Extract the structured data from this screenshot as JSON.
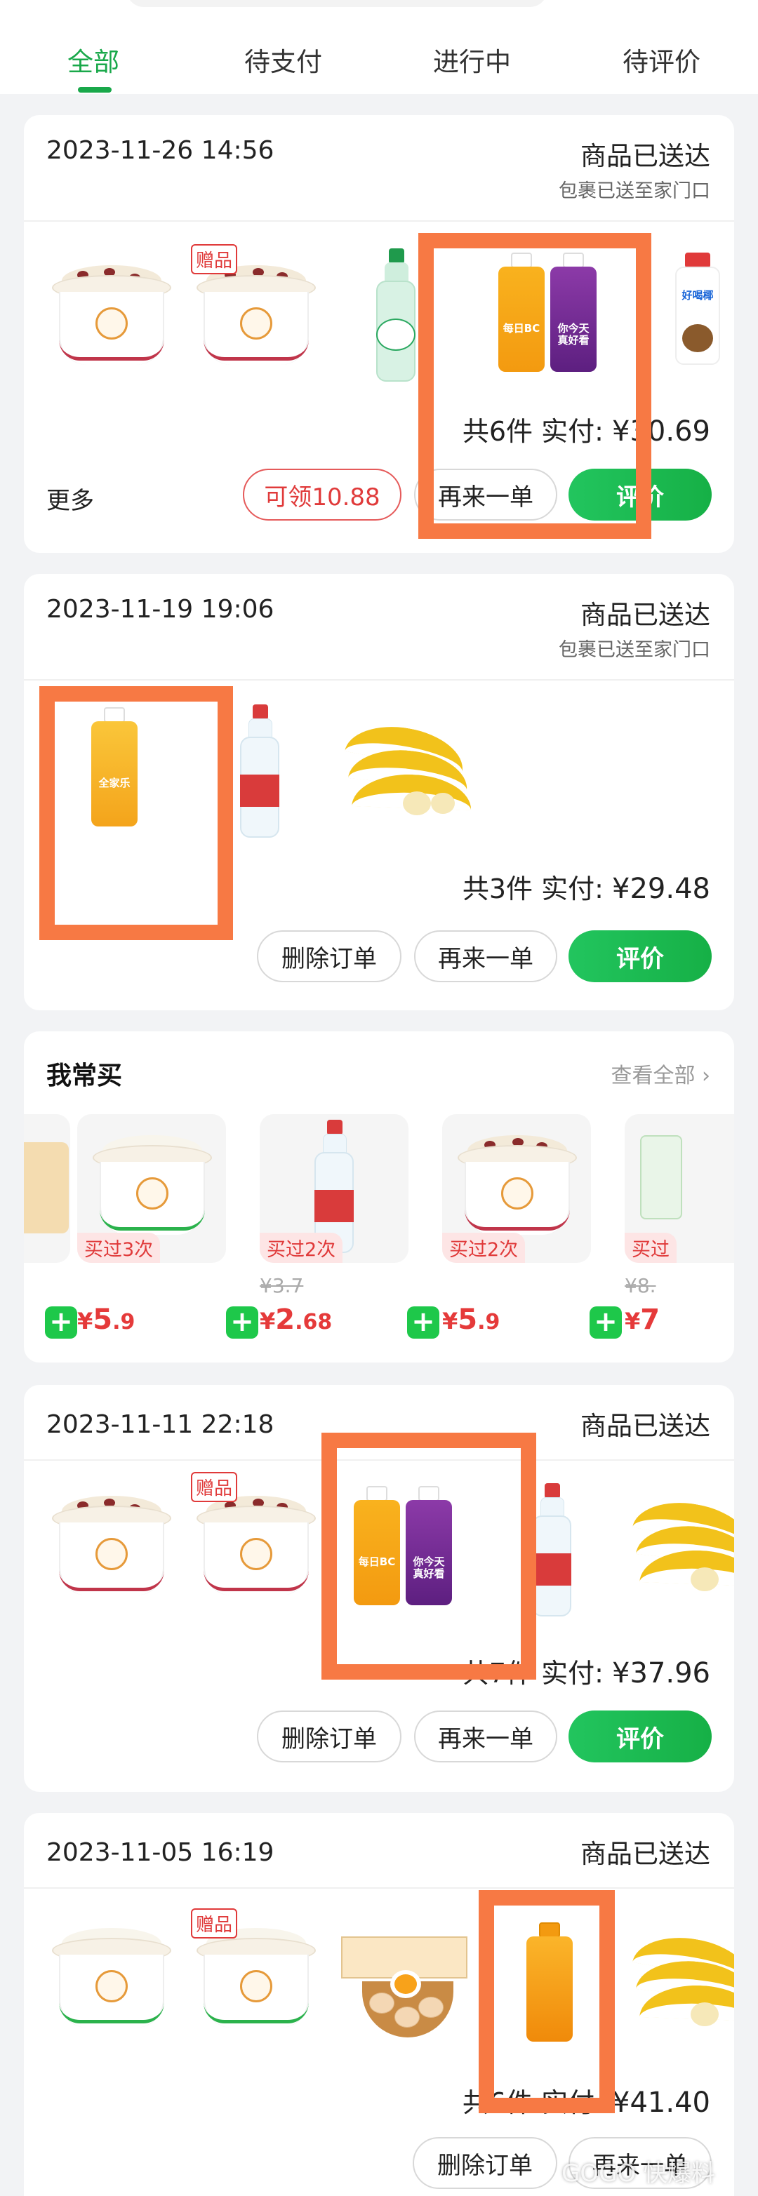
{
  "tabs": [
    "全部",
    "待支付",
    "进行中",
    "待评价"
  ],
  "active_tab": "全部",
  "orders": [
    {
      "datetime": "2023-11-26 14:56",
      "status": "商品已送达",
      "sub_status": "包裹已送至家门口",
      "gift_label": "赠品",
      "summary_count": "共6件",
      "summary_paid_label": "实付:",
      "summary_amount": "¥30.69",
      "more_label": "更多",
      "coupon_button": "可领10.88",
      "reorder_button": "再来一单",
      "review_button": "评价"
    },
    {
      "datetime": "2023-11-19 19:06",
      "status": "商品已送达",
      "sub_status": "包裹已送至家门口",
      "summary_count": "共3件",
      "summary_paid_label": "实付:",
      "summary_amount": "¥29.48",
      "delete_button": "删除订单",
      "reorder_button": "再来一单",
      "review_button": "评价"
    },
    {
      "datetime": "2023-11-11 22:18",
      "status": "商品已送达",
      "gift_label": "赠品",
      "summary_count": "共7件",
      "summary_paid_label": "实付:",
      "summary_amount": "¥37.96",
      "delete_button": "删除订单",
      "reorder_button": "再来一单",
      "review_button": "评价"
    },
    {
      "datetime": "2023-11-05 16:19",
      "status": "商品已送达",
      "gift_label": "赠品",
      "summary_count": "共6件",
      "summary_paid_label": "实付:",
      "summary_amount": "¥41.40",
      "delete_button": "删除订单",
      "reorder_button": "再来一单"
    }
  ],
  "frequent_buy": {
    "title": "我常买",
    "view_all": "查看全部 ›",
    "items": [
      {
        "badge": "买过3次",
        "orig_price": "",
        "price_yen": "¥",
        "price_int": "5",
        "price_dec": ".9"
      },
      {
        "badge": "买过2次",
        "orig_price": "¥3.7",
        "price_yen": "¥",
        "price_int": "2",
        "price_dec": ".68"
      },
      {
        "badge": "买过2次",
        "orig_price": "",
        "price_yen": "¥",
        "price_int": "5",
        "price_dec": ".9"
      },
      {
        "badge": "买过",
        "orig_price": "¥8.",
        "price_yen": "¥",
        "price_int": "7",
        "price_dec": ""
      }
    ]
  },
  "product_labels": {
    "juice_orange": "每日BC",
    "juice_grape": "你今天真好看",
    "juice_family": "全家乐",
    "coconut": "好喝椰"
  },
  "watermark": "GOGO 快爆料",
  "colors": {
    "accent_green": "#19a84a",
    "button_green": "#1ec84a",
    "price_red": "#e53a3a",
    "highlight_orange": "#f77944"
  }
}
